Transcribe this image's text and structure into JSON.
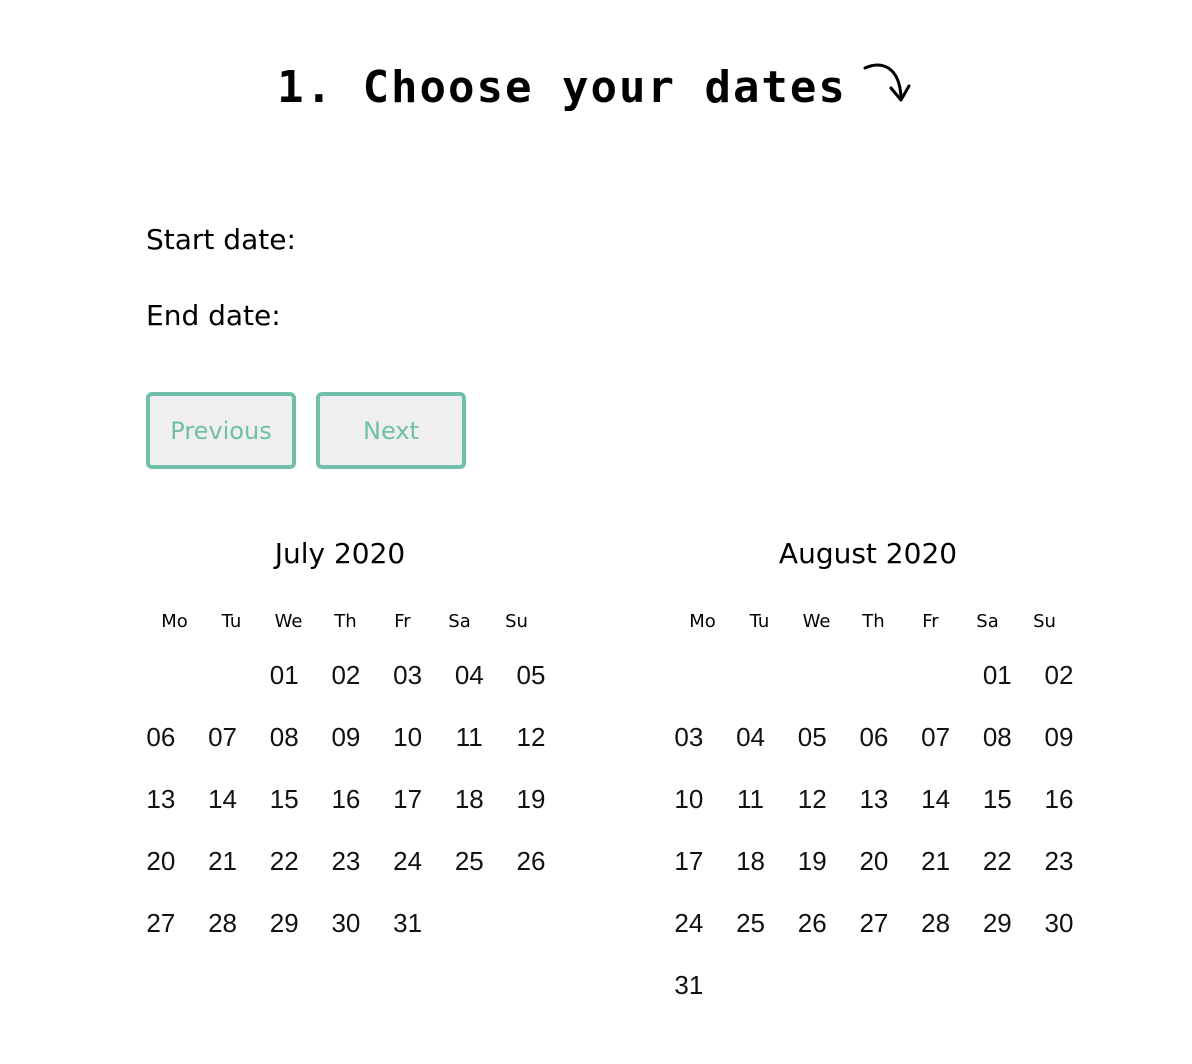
{
  "header": {
    "title": "1. Choose your dates",
    "arrow_icon": "curved-arrow-down-right-icon"
  },
  "fields": {
    "start_label": "Start date:",
    "end_label": "End date:"
  },
  "nav": {
    "previous_label": "Previous",
    "next_label": "Next"
  },
  "colors": {
    "accent": "#6fbfaa",
    "button_bg": "#efefef"
  },
  "calendars": [
    {
      "title": "July 2020",
      "weekdays": [
        "Mo",
        "Tu",
        "We",
        "Th",
        "Fr",
        "Sa",
        "Su"
      ],
      "leading_blanks": 2,
      "days": [
        "01",
        "02",
        "03",
        "04",
        "05",
        "06",
        "07",
        "08",
        "09",
        "10",
        "11",
        "12",
        "13",
        "14",
        "15",
        "16",
        "17",
        "18",
        "19",
        "20",
        "21",
        "22",
        "23",
        "24",
        "25",
        "26",
        "27",
        "28",
        "29",
        "30",
        "31"
      ]
    },
    {
      "title": "August 2020",
      "weekdays": [
        "Mo",
        "Tu",
        "We",
        "Th",
        "Fr",
        "Sa",
        "Su"
      ],
      "leading_blanks": 5,
      "days": [
        "01",
        "02",
        "03",
        "04",
        "05",
        "06",
        "07",
        "08",
        "09",
        "10",
        "11",
        "12",
        "13",
        "14",
        "15",
        "16",
        "17",
        "18",
        "19",
        "20",
        "21",
        "22",
        "23",
        "24",
        "25",
        "26",
        "27",
        "28",
        "29",
        "30",
        "31"
      ]
    }
  ]
}
